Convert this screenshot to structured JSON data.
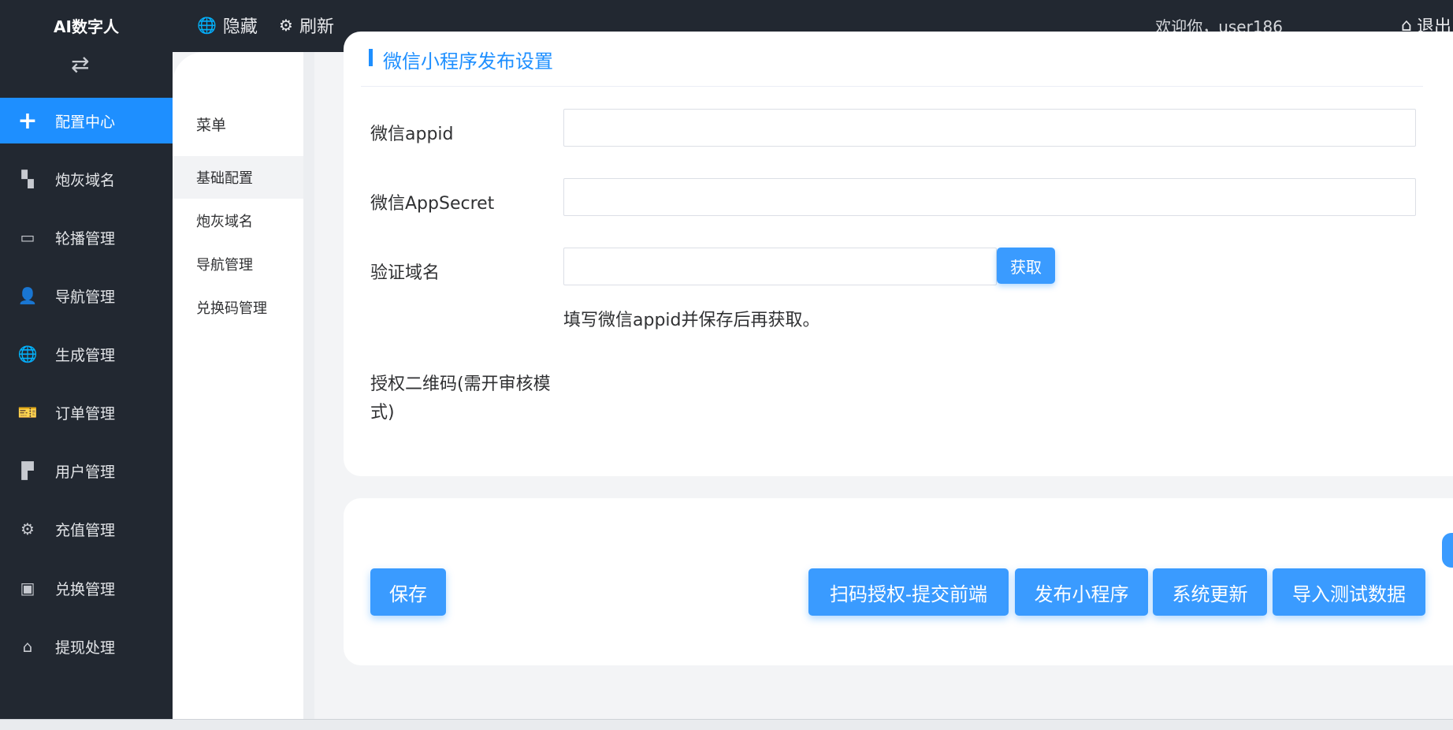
{
  "app": {
    "brand": "AI数字人",
    "swap_icon": "⇄"
  },
  "topbar": {
    "hide_label": "隐藏",
    "refresh_label": "刷新",
    "welcome": "欢迎你，user186",
    "logout_label": "退出"
  },
  "sidebar": {
    "items": [
      {
        "label": "配置中心",
        "icon": "plus-icon",
        "glyph": "+"
      },
      {
        "label": "炮灰域名",
        "icon": "apps-icon",
        "glyph": "▚"
      },
      {
        "label": "轮播管理",
        "icon": "card-icon",
        "glyph": "▭"
      },
      {
        "label": "导航管理",
        "icon": "user-icon",
        "glyph": "👤"
      },
      {
        "label": "生成管理",
        "icon": "globe-icon",
        "glyph": "🌐"
      },
      {
        "label": "订单管理",
        "icon": "ticket-icon",
        "glyph": "🎫"
      },
      {
        "label": "用户管理",
        "icon": "shop-icon",
        "glyph": "▛"
      },
      {
        "label": "充值管理",
        "icon": "gear-icon",
        "glyph": "⚙"
      },
      {
        "label": "兑换管理",
        "icon": "vip-icon",
        "glyph": "▣"
      },
      {
        "label": "提现处理",
        "icon": "home-icon",
        "glyph": "⌂"
      }
    ]
  },
  "subnav": {
    "title": "菜单",
    "items": [
      {
        "label": "基础配置"
      },
      {
        "label": "炮灰域名"
      },
      {
        "label": "导航管理"
      },
      {
        "label": "兑换码管理"
      }
    ]
  },
  "section": {
    "title": "微信小程序发布设置",
    "appid_label": "微信appid",
    "appid_value": "",
    "secret_label": "微信AppSecret",
    "secret_value": "",
    "domain_label": "验证域名",
    "domain_value": "",
    "fetch_label": "获取",
    "hint": "填写微信appid并保存后再获取。",
    "qr_label": "授权二维码(需开审核模式)"
  },
  "actions": {
    "save": "保存",
    "scan_submit": "扫码授权-提交前端",
    "publish": "发布小程序",
    "update": "系统更新",
    "import_test": "导入测试数据"
  },
  "colors": {
    "accent": "#1e8fff",
    "dark": "#222831"
  }
}
